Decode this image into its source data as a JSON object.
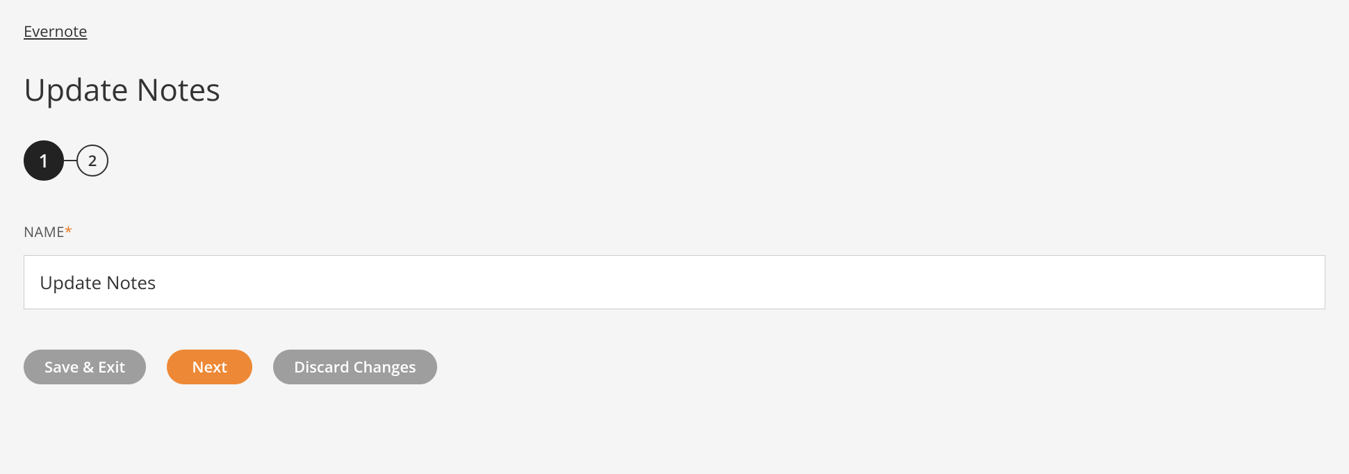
{
  "breadcrumb": {
    "parent": "Evernote"
  },
  "page": {
    "title": "Update Notes"
  },
  "stepper": {
    "steps": [
      "1",
      "2"
    ],
    "current": 0
  },
  "form": {
    "name_label": "NAME",
    "required_mark": "*",
    "name_value": "Update Notes"
  },
  "buttons": {
    "save_exit": "Save & Exit",
    "next": "Next",
    "discard": "Discard Changes"
  }
}
